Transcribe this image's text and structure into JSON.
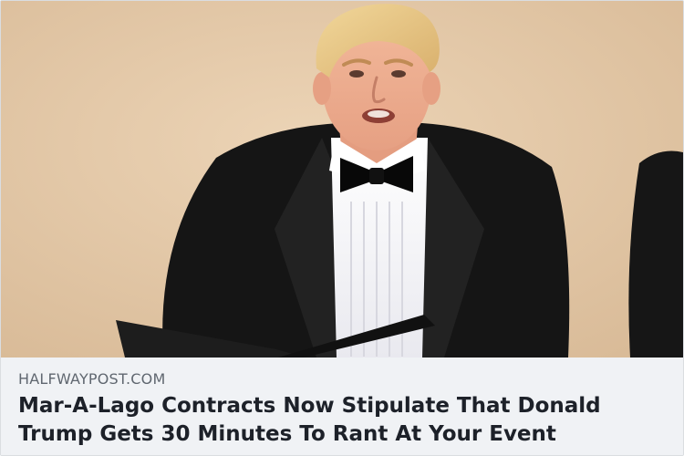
{
  "link_preview": {
    "image": {
      "subject": "man in black tuxedo with bow tie reading from a black folder",
      "background_color": "#e2c7a6"
    },
    "domain": "HALFWAYPOST.COM",
    "headline": "Mar-A-Lago Contracts Now Stipulate That Donald Trump Gets 30 Minutes To Rant At Your Event"
  }
}
